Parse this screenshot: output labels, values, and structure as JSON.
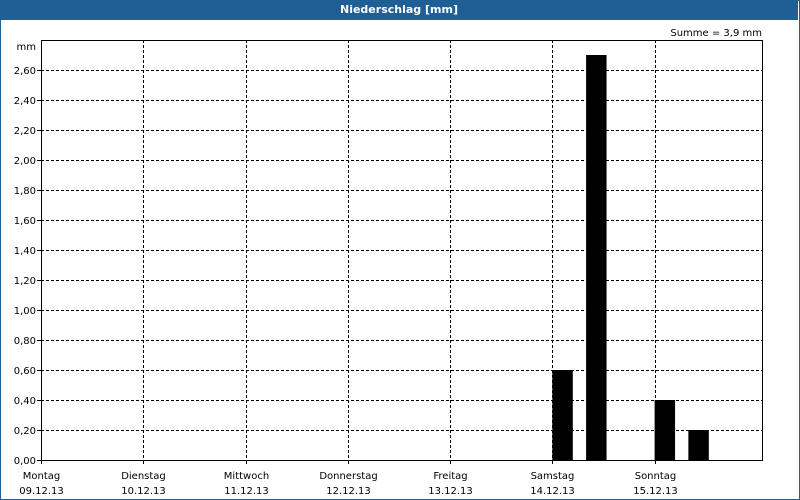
{
  "chart_data": {
    "type": "bar",
    "title": "Niederschlag [mm]",
    "annotation": "Summe = 3,9 mm",
    "ylabel": "mm",
    "ylim": [
      0,
      2.8
    ],
    "y_ticks": [
      "0,00",
      "0,20",
      "0,40",
      "0,60",
      "0,80",
      "1,00",
      "1,20",
      "1,40",
      "1,60",
      "1,80",
      "2,00",
      "2,20",
      "2,40",
      "2,60"
    ],
    "x_range": [
      0,
      7.05
    ],
    "days": [
      {
        "name": "Montag",
        "date": "09.12.13"
      },
      {
        "name": "Dienstag",
        "date": "10.12.13"
      },
      {
        "name": "Mittwoch",
        "date": "11.12.13"
      },
      {
        "name": "Donnerstag",
        "date": "12.12.13"
      },
      {
        "name": "Freitag",
        "date": "13.12.13"
      },
      {
        "name": "Samstag",
        "date": "14.12.13"
      },
      {
        "name": "Sonntag",
        "date": "15.12.13"
      }
    ],
    "bars": [
      {
        "x": 5.0,
        "value": 0.6
      },
      {
        "x": 5.33,
        "value": 2.7
      },
      {
        "x": 6.0,
        "value": 0.4
      },
      {
        "x": 6.33,
        "value": 0.2
      }
    ],
    "bar_width_days": 0.2,
    "grid": true,
    "colors": {
      "title_bar": "#1f5f96",
      "bars": "#000000",
      "grid": "#000000"
    }
  }
}
